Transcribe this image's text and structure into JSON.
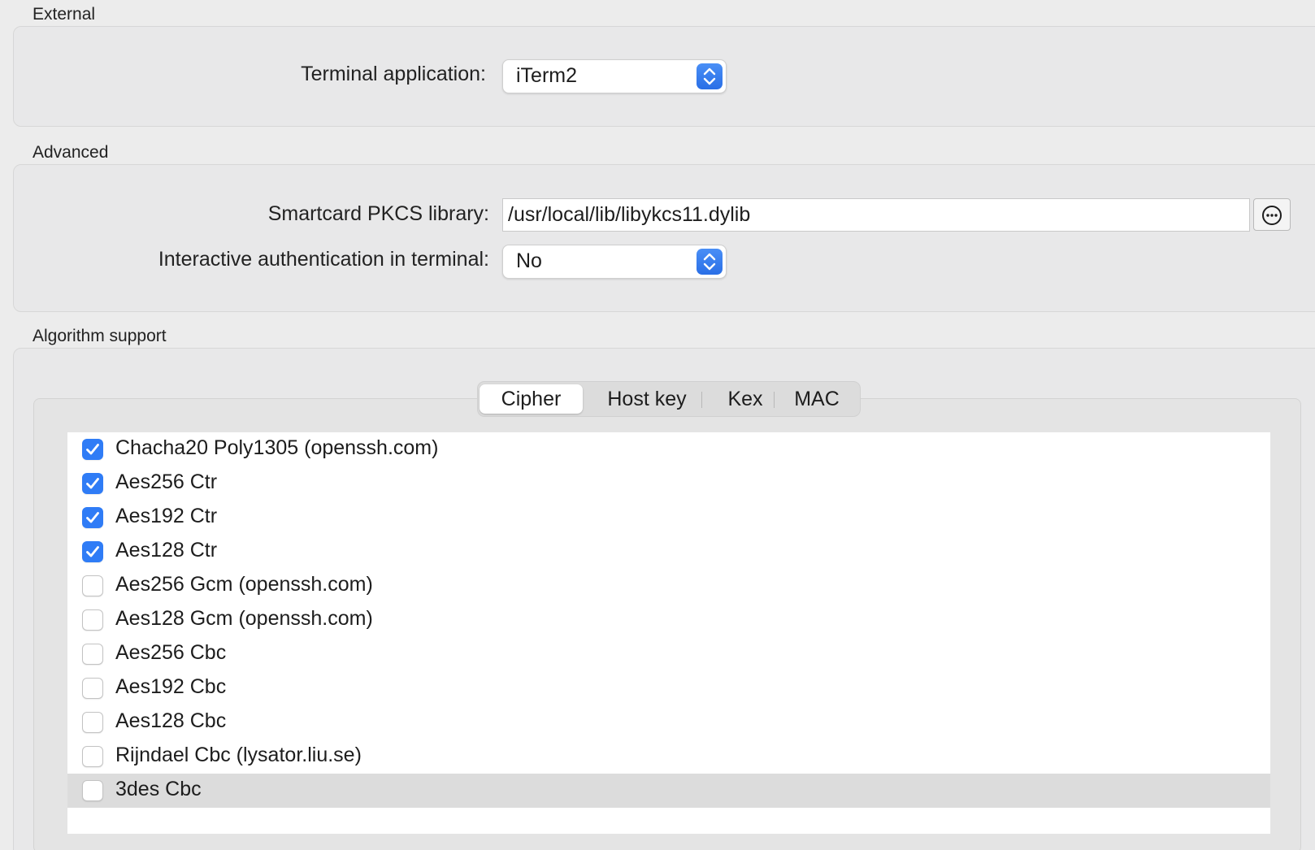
{
  "sections": {
    "external_title": "External",
    "advanced_title": "Advanced",
    "algorithm_title": "Algorithm support"
  },
  "external": {
    "terminal_label": "Terminal application:",
    "terminal_value": "iTerm2"
  },
  "advanced": {
    "pkcs_label": "Smartcard PKCS library:",
    "pkcs_value": "/usr/local/lib/libykcs11.dylib",
    "interactive_label": "Interactive authentication in terminal:",
    "interactive_value": "No"
  },
  "tabs": [
    {
      "label": "Cipher",
      "active": true
    },
    {
      "label": "Host key",
      "active": false
    },
    {
      "label": "Kex",
      "active": false
    },
    {
      "label": "MAC",
      "active": false
    }
  ],
  "ciphers": [
    {
      "label": "Chacha20 Poly1305 (openssh.com)",
      "checked": true
    },
    {
      "label": "Aes256 Ctr",
      "checked": true
    },
    {
      "label": "Aes192 Ctr",
      "checked": true
    },
    {
      "label": "Aes128 Ctr",
      "checked": true
    },
    {
      "label": "Aes256 Gcm (openssh.com)",
      "checked": false
    },
    {
      "label": "Aes128 Gcm (openssh.com)",
      "checked": false
    },
    {
      "label": "Aes256 Cbc",
      "checked": false
    },
    {
      "label": "Aes192 Cbc",
      "checked": false
    },
    {
      "label": "Aes128 Cbc",
      "checked": false
    },
    {
      "label": "Rijndael Cbc (lysator.liu.se)",
      "checked": false
    },
    {
      "label": "3des Cbc",
      "checked": false,
      "selected": true
    }
  ],
  "colors": {
    "accent": "#2f7cf6",
    "selected_row": "#dcdcdc",
    "window_bg": "#ececec"
  }
}
